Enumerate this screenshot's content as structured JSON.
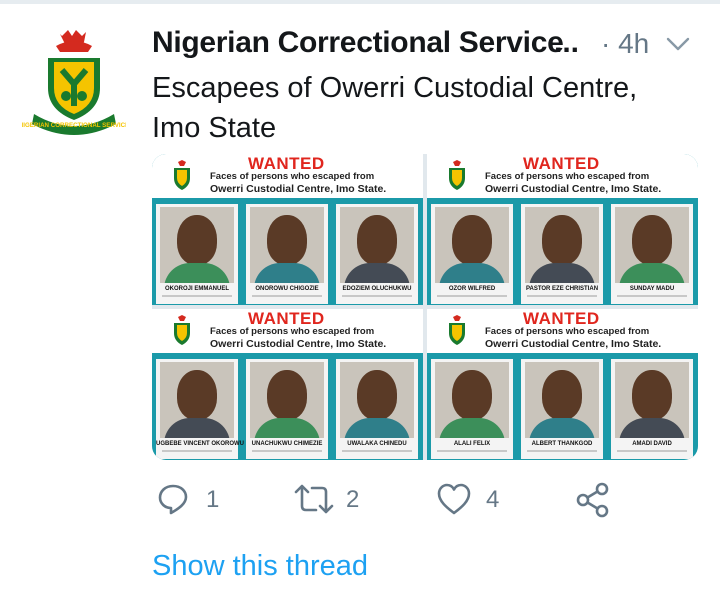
{
  "tweet": {
    "author": "Nigerian Correctional Service",
    "ellipsis": "...",
    "time": "· 4h",
    "text_lines": [
      "Escapees of Owerri Custodial Centre,",
      "Imo State"
    ],
    "avatar_icon": "nigerian-correctional-service-logo-icon",
    "avatar_logo_text": "NIGERIAN CORRECTIONAL SERVICE"
  },
  "media": {
    "panels": [
      {
        "wanted": "WANTED",
        "line1": "Faces of persons who escaped from",
        "line2": "Owerri Custodial Centre, Imo State.",
        "names": [
          "OKOROJI EMMANUEL",
          "ONOROWU CHIGOZIE",
          "EDOZIEM OLUCHUKWU"
        ]
      },
      {
        "wanted": "WANTED",
        "line1": "Faces of persons who escaped from",
        "line2": "Owerri Custodial Centre, Imo State.",
        "names": [
          "OZOR WILFRED",
          "PASTOR EZE CHRISTIAN",
          "SUNDAY MADU"
        ]
      },
      {
        "wanted": "WANTED",
        "line1": "Faces of persons who escaped from",
        "line2": "Owerri Custodial Centre, Imo State.",
        "names": [
          "UGBEBE VINCENT OKOROWU",
          "UNACHUKWU CHIMEZIE",
          "UWALAKA CHINEDU"
        ]
      },
      {
        "wanted": "WANTED",
        "line1": "Faces of persons who escaped from",
        "line2": "Owerri Custodial Centre, Imo State.",
        "names": [
          "ALALI FELIX",
          "ALBERT THANKGOD",
          "AMADI DAVID"
        ]
      }
    ]
  },
  "actions": {
    "reply": {
      "icon": "reply-icon",
      "count": "1"
    },
    "retweet": {
      "icon": "retweet-icon",
      "count": "2"
    },
    "like": {
      "icon": "heart-icon",
      "count": "4"
    },
    "share": {
      "icon": "share-icon"
    }
  },
  "show_thread": "Show this thread",
  "colors": {
    "text": "#14171a",
    "muted": "#657786",
    "link": "#1da1f2",
    "poster_teal": "#1b9aa9",
    "wanted_red": "#e0261e"
  }
}
